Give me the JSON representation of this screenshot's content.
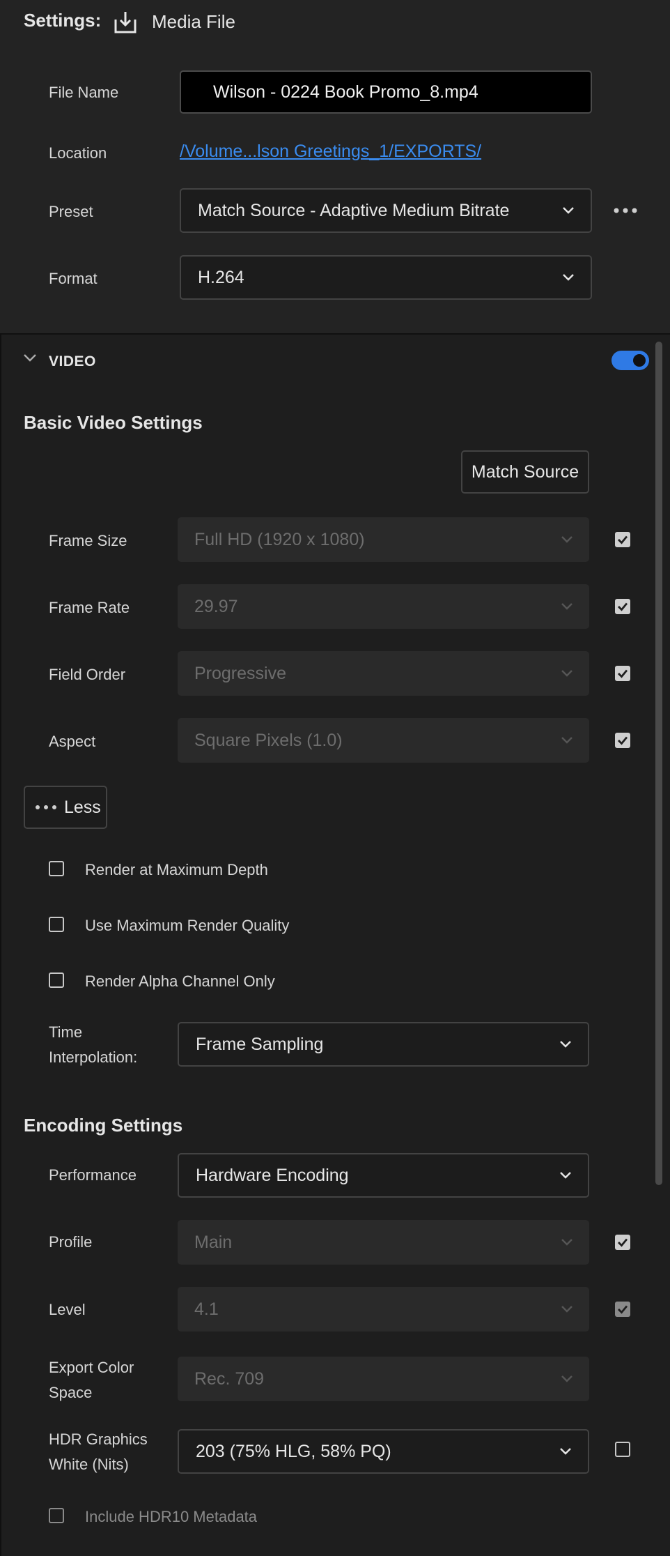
{
  "header": {
    "title": "Settings:",
    "subtitle": "Media File",
    "icon": "download-icon"
  },
  "file_name": {
    "label": "File Name",
    "value": "Wilson - 0224 Book Promo_8.mp4"
  },
  "location": {
    "label": "Location",
    "value": "/Volume...lson Greetings_1/EXPORTS/"
  },
  "preset": {
    "label": "Preset",
    "value": "Match Source - Adaptive Medium Bitrate",
    "more_icon": "more-horizontal-icon"
  },
  "format": {
    "label": "Format",
    "value": "H.264"
  },
  "video": {
    "label": "VIDEO",
    "enabled": true,
    "accent": "#2f7ae5"
  },
  "basic_video": {
    "title": "Basic Video Settings",
    "match_source_label": "Match Source",
    "frame_size": {
      "label": "Frame Size",
      "value": "Full HD (1920 x 1080)",
      "checked": true
    },
    "frame_rate": {
      "label": "Frame Rate",
      "value": "29.97",
      "checked": true
    },
    "field_order": {
      "label": "Field Order",
      "value": "Progressive",
      "checked": true
    },
    "aspect": {
      "label": "Aspect",
      "value": "Square Pixels (1.0)",
      "checked": true
    },
    "less_label": "Less",
    "render_max_depth": {
      "label": "Render at Maximum Depth",
      "checked": false
    },
    "max_render_quality": {
      "label": "Use Maximum Render Quality",
      "checked": false
    },
    "alpha_only": {
      "label": "Render Alpha Channel Only",
      "checked": false
    },
    "time_interpolation": {
      "label_line1": "Time",
      "label_line2": "Interpolation:",
      "value": "Frame Sampling"
    }
  },
  "encoding": {
    "title": "Encoding Settings",
    "performance": {
      "label": "Performance",
      "value": "Hardware Encoding"
    },
    "profile": {
      "label": "Profile",
      "value": "Main",
      "checked": true
    },
    "level": {
      "label": "Level",
      "value": "4.1",
      "checked": true
    },
    "export_color_space": {
      "label_line1": "Export Color",
      "label_line2": "Space",
      "value": "Rec. 709"
    },
    "hdr_white": {
      "label_line1": "HDR Graphics",
      "label_line2": "White (Nits)",
      "value": "203 (75% HLG, 58% PQ)",
      "checked": false
    },
    "hdr10_metadata": {
      "label": "Include HDR10 Metadata",
      "checked": false
    }
  }
}
